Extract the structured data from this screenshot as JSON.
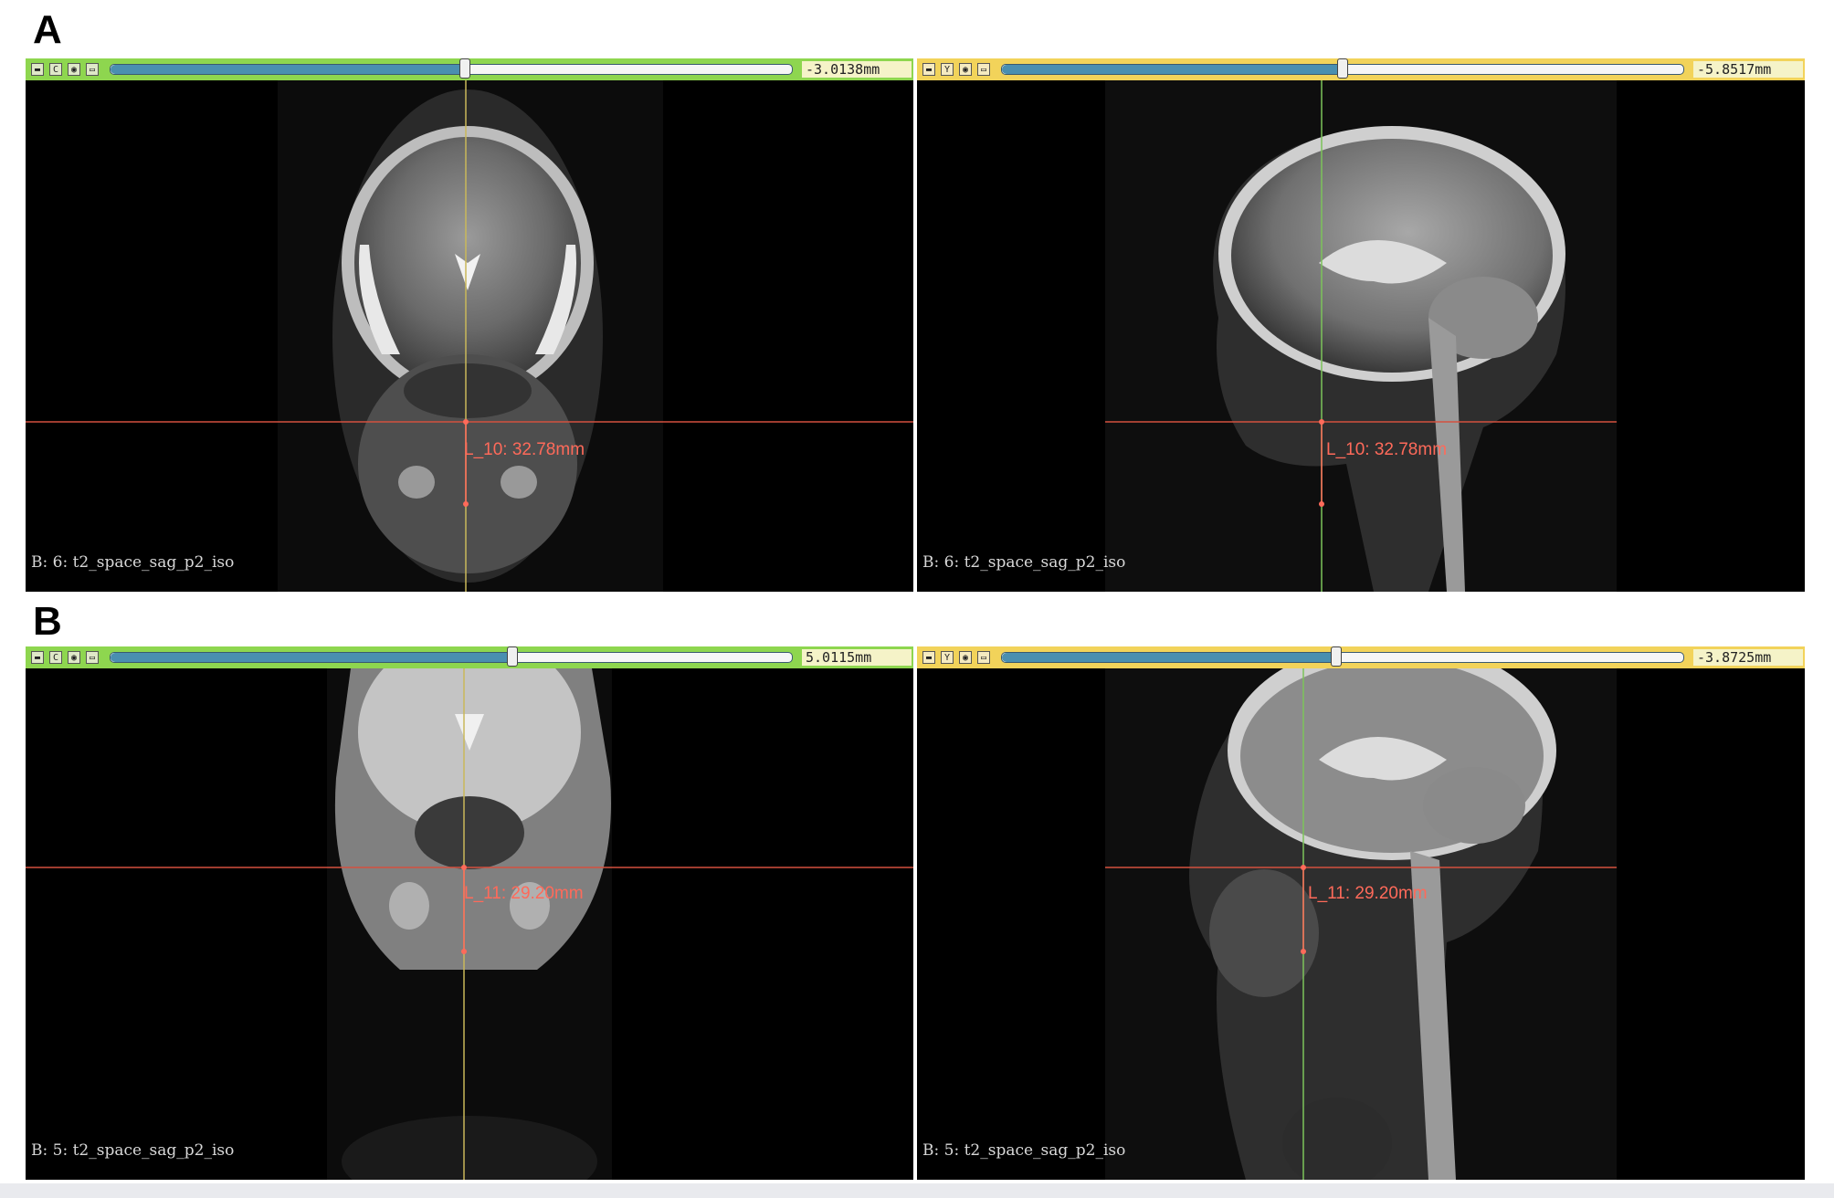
{
  "panels": [
    {
      "label": "A",
      "viewers": [
        {
          "axis_letter": "C",
          "theme": "green",
          "slider_position": 0.52,
          "value": "-3.0138mm",
          "measurement": "L_10: 32.78mm",
          "series": "B: 6: t2_space_sag_p2_iso"
        },
        {
          "axis_letter": "Y",
          "theme": "yellow",
          "slider_position": 0.5,
          "value": "-5.8517mm",
          "measurement": "L_10: 32.78mm",
          "series": "B: 6: t2_space_sag_p2_iso"
        }
      ]
    },
    {
      "label": "B",
      "viewers": [
        {
          "axis_letter": "C",
          "theme": "green",
          "slider_position": 0.59,
          "value": "5.0115mm",
          "measurement": "L_11: 29.20mm",
          "series": "B: 5: t2_space_sag_p2_iso"
        },
        {
          "axis_letter": "Y",
          "theme": "yellow",
          "slider_position": 0.49,
          "value": "-3.8725mm",
          "measurement": "L_11: 29.20mm",
          "series": "B: 5: t2_space_sag_p2_iso"
        }
      ]
    }
  ],
  "colors": {
    "toolbar_green": "#8ed64f",
    "toolbar_yellow": "#f2d35a",
    "crosshair_red": "#d4513f",
    "crosshair_yellow": "#c9b85a",
    "crosshair_green": "#7cc35a",
    "measure_text": "#ff6a5a"
  },
  "icons": [
    "pin-icon",
    "camera-icon",
    "window-icon"
  ]
}
